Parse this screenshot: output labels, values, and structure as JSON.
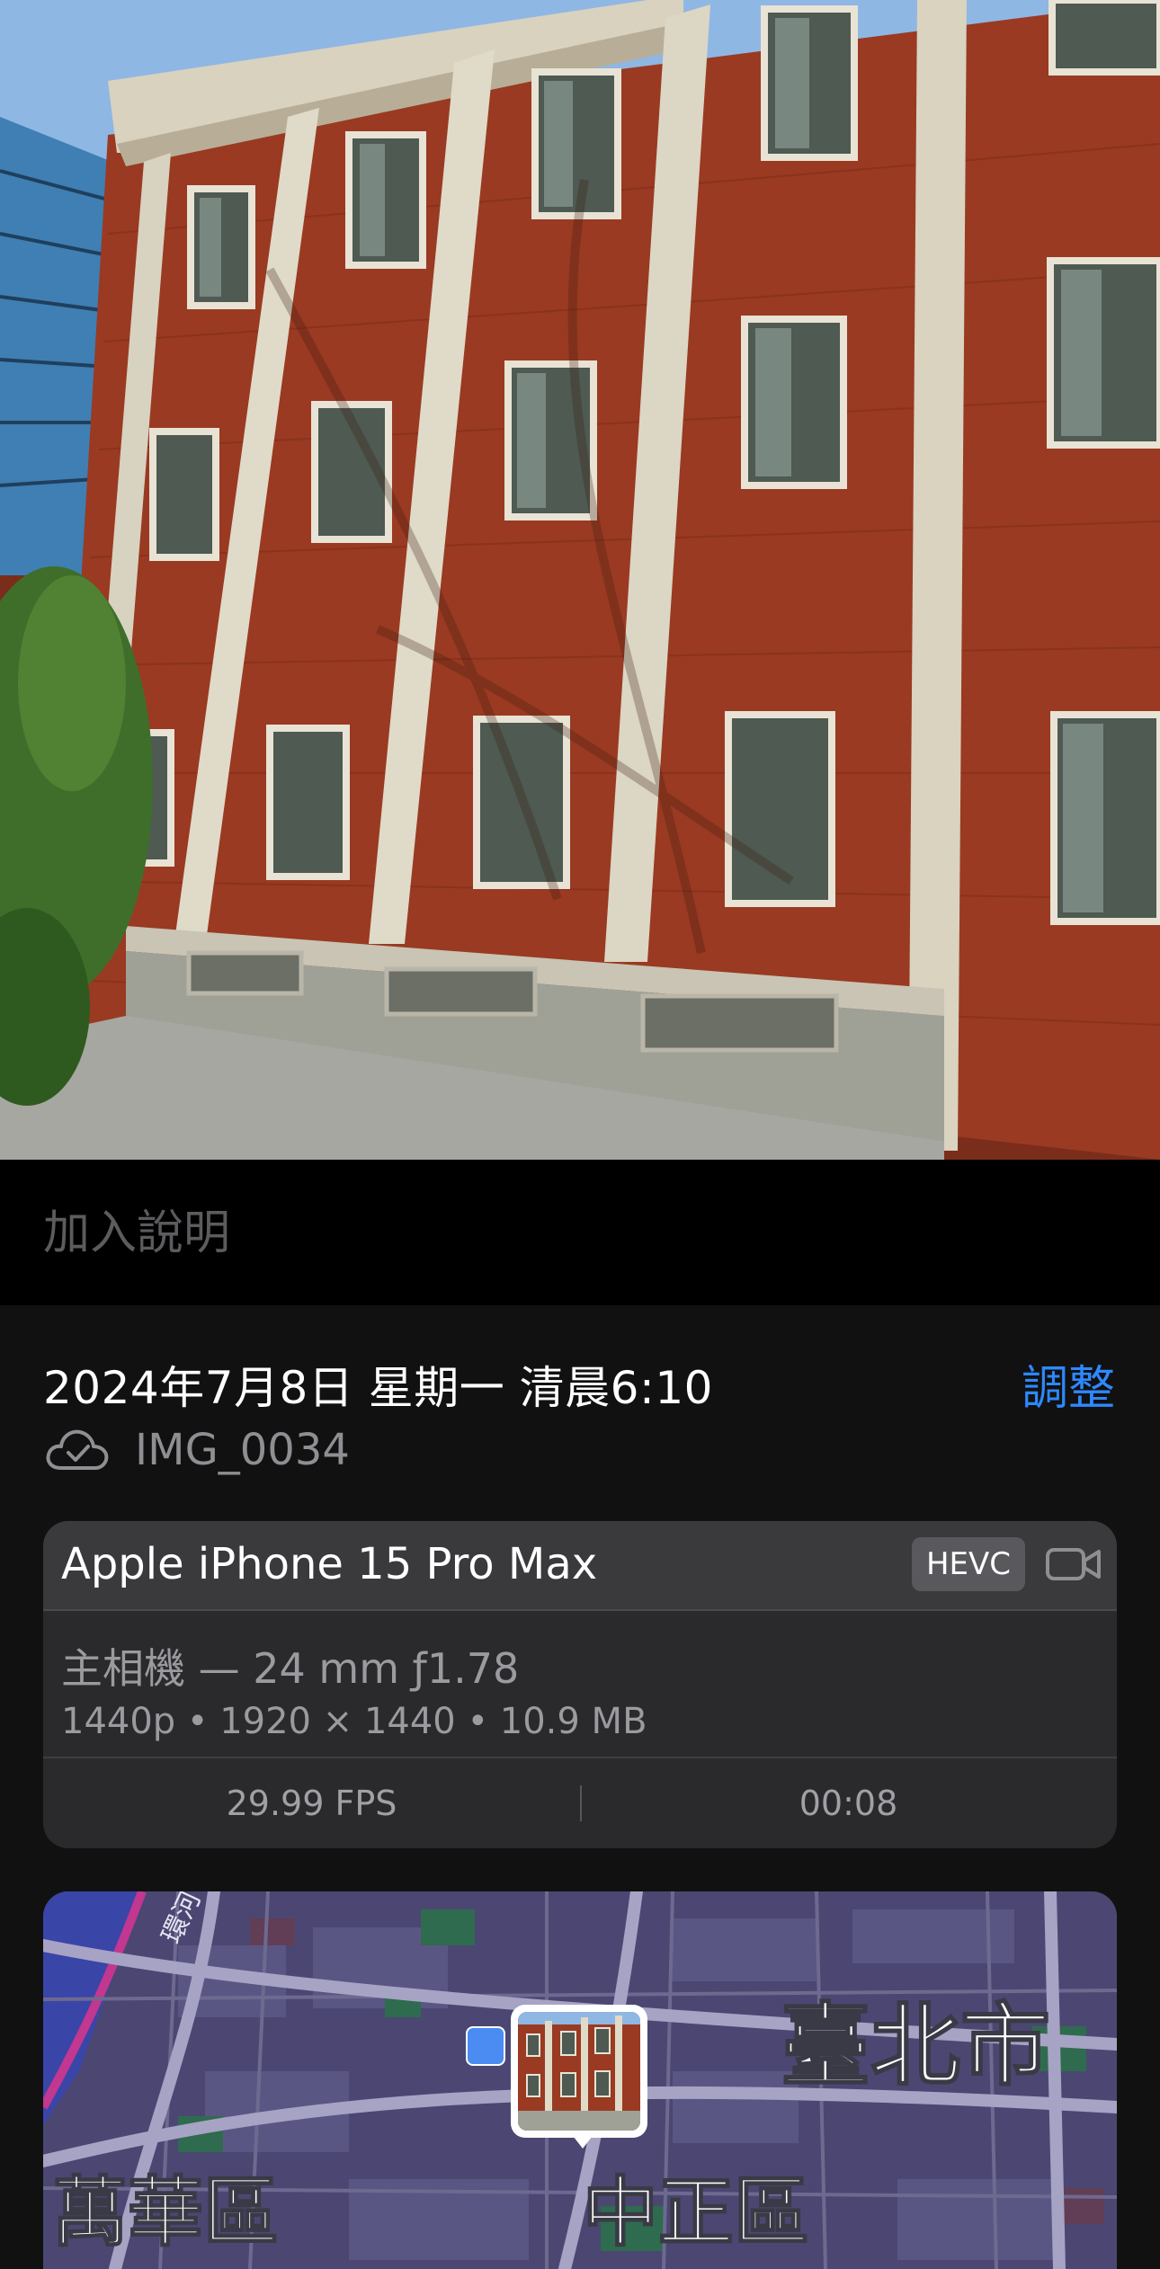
{
  "caption": {
    "placeholder": "加入說明"
  },
  "info": {
    "datetime": "2024年7月8日 星期一 清晨6:10",
    "adjust_label": "調整",
    "file_name": "IMG_0034",
    "cloud_icon": "icloud-check-icon"
  },
  "camera": {
    "device": "Apple iPhone 15 Pro Max",
    "codec": "HEVC",
    "media_icon": "video-camera-icon",
    "lens": "主相機 — 24 mm ƒ1.78",
    "specs": "1440p • 1920 × 1440 • 10.9 MB",
    "fps": "29.99 FPS",
    "duration": "00:08"
  },
  "map": {
    "city_label": "臺北市",
    "district_left": "萬華區",
    "district_right": "中正區",
    "road_label": "環河",
    "metro_icon": "metro-station-icon"
  },
  "colors": {
    "accent": "#2e88ff",
    "panel": "#111111",
    "card": "#2a2a2d",
    "brick": "#9a3a22"
  }
}
